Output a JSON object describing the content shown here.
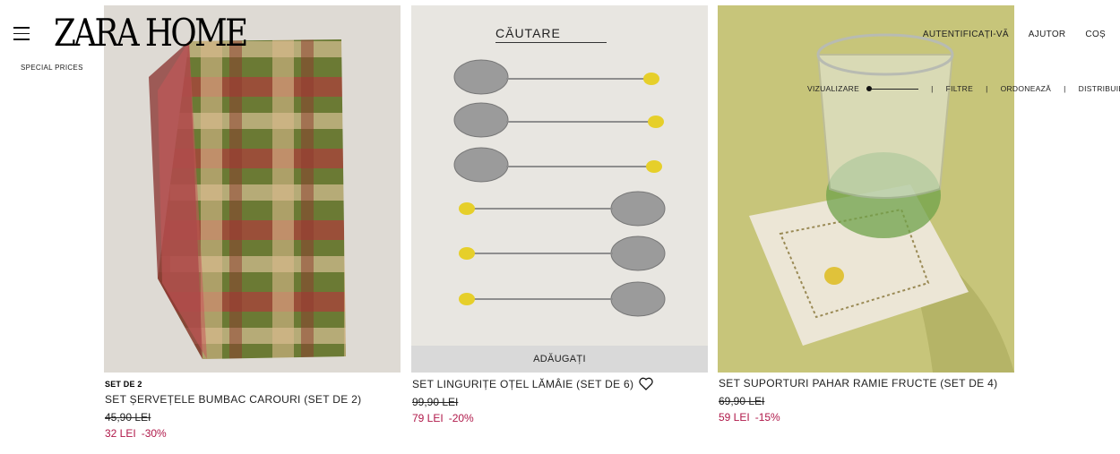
{
  "header": {
    "logo": "ZARA HOME",
    "special": "SPECIAL PRICES",
    "search": "CĂUTARE",
    "nav": [
      "AUTENTIFICAȚI-VĂ",
      "AJUTOR",
      "COȘ"
    ]
  },
  "toolbar": {
    "view": "VIZUALIZARE",
    "filters": "FILTRE",
    "sort": "ORDONEAZĂ",
    "share": "DISTRIBUIE"
  },
  "products": [
    {
      "tag": "SET DE 2",
      "name": "SET ȘERVEȚELE BUMBAC CAROURI (SET DE 2)",
      "old": "45,90 LEI",
      "price": "32 LEI",
      "discount": "-30%"
    },
    {
      "name": "SET LINGURIȚE OȚEL LĂMÂIE (SET DE 6)",
      "old": "99,90 LEI",
      "price": "79 LEI",
      "discount": "-20%",
      "add": "ADĂUGAȚI"
    },
    {
      "name": "SET SUPORTURI PAHAR RAMIE FRUCTE (SET DE 4)",
      "old": "69,90 LEI",
      "price": "59 LEI",
      "discount": "-15%"
    }
  ],
  "colors": {
    "sale": "#b0194a"
  }
}
